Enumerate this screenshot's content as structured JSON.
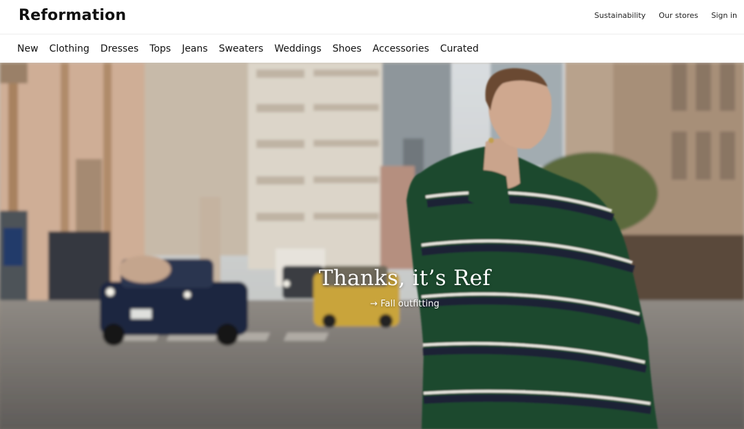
{
  "header": {
    "logo": "Reformation",
    "utility_links": [
      {
        "label": "Sustainability"
      },
      {
        "label": "Our stores"
      },
      {
        "label": "Sign in"
      }
    ]
  },
  "nav": {
    "items": [
      {
        "label": "New"
      },
      {
        "label": "Clothing"
      },
      {
        "label": "Dresses"
      },
      {
        "label": "Tops"
      },
      {
        "label": "Jeans"
      },
      {
        "label": "Sweaters"
      },
      {
        "label": "Weddings"
      },
      {
        "label": "Shoes"
      },
      {
        "label": "Accessories"
      },
      {
        "label": "Curated"
      }
    ]
  },
  "hero": {
    "title": "Thanks, it’s Ref",
    "link_arrow": "→",
    "link_label": "Fall outfitting",
    "colors": {
      "sweater_green": "#1f4a2e",
      "sweater_navy": "#1c2236",
      "stripe_white": "#e9e6df",
      "taxi_yellow": "#c9a43b",
      "car_navy": "#1d2740"
    }
  }
}
